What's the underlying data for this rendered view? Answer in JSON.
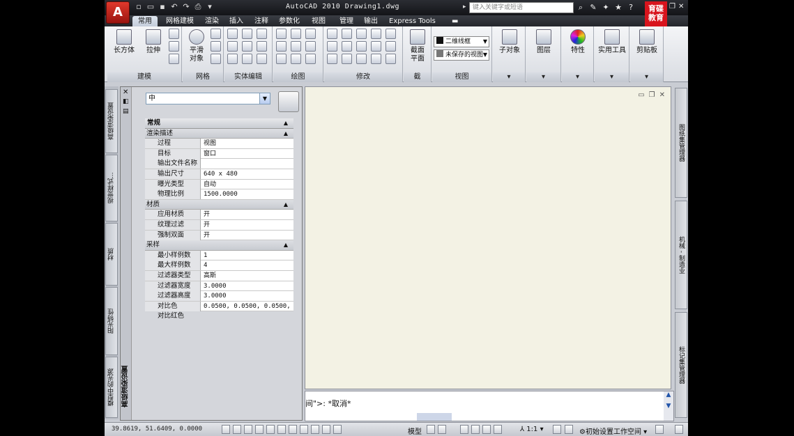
{
  "titlebar": {
    "title": "AutoCAD 2010  Drawing1.dwg",
    "search_placeholder": "键入关键字或短语",
    "logo_line1": "育",
    "logo_line2": "碟",
    "logo_line3": "教育"
  },
  "ribbon_tabs": [
    "常用",
    "网格建模",
    "渲染",
    "插入",
    "注释",
    "参数化",
    "视图",
    "管理",
    "输出",
    "Express Tools"
  ],
  "ribbon": {
    "modeling": {
      "box": "长方体",
      "extrude": "拉伸",
      "label": "建模"
    },
    "mesh": {
      "smooth_line1": "平滑",
      "smooth_line2": "对象",
      "label": "网格"
    },
    "solid_edit": {
      "label": "实体编辑"
    },
    "draw": {
      "label": "绘图"
    },
    "modify": {
      "label": "修改"
    },
    "section": {
      "label": "截",
      "plane_line1": "截面",
      "plane_line2": "平面"
    },
    "view": {
      "visual_style": "二维线框",
      "saved_view": "未保存的视图",
      "label": "视图"
    },
    "subobject": {
      "label": "子对象"
    },
    "layers": {
      "label": "图层"
    },
    "properties": {
      "label": "特性"
    },
    "utilities": {
      "label": "实用工具"
    },
    "clipboard": {
      "label": "剪贴板"
    }
  },
  "left_tabs": [
    "高级渲染设置",
    "视觉样式...",
    "材质",
    "阳光特性",
    "模型中的光源"
  ],
  "palette": {
    "title": "高级渲染设置",
    "preset": "中",
    "section_general": "常规",
    "sub_render": "渲染描述",
    "render_rows": [
      {
        "key": "过程",
        "value": "视图"
      },
      {
        "key": "目标",
        "value": "窗口"
      },
      {
        "key": "输出文件名称",
        "value": ""
      },
      {
        "key": "输出尺寸",
        "value": "640 x 480"
      },
      {
        "key": "曝光类型",
        "value": "自动"
      },
      {
        "key": "物理比例",
        "value": "1500.0000"
      }
    ],
    "sub_material": "材质",
    "material_rows": [
      {
        "key": "应用材质",
        "value": "开"
      },
      {
        "key": "纹理过滤",
        "value": "开"
      },
      {
        "key": "强制双面",
        "value": "开"
      }
    ],
    "sub_sampling": "采样",
    "sampling_rows": [
      {
        "key": "最小样例数",
        "value": "1"
      },
      {
        "key": "最大样例数",
        "value": "4"
      },
      {
        "key": "过滤器类型",
        "value": "高斯"
      },
      {
        "key": "过滤器宽度",
        "value": "3.0000"
      },
      {
        "key": "过滤器高度",
        "value": "3.0000"
      },
      {
        "key": "对比色",
        "value": "0.0500, 0.0500, 0.0500, ..."
      }
    ],
    "last_row": "对比红色"
  },
  "right_tabs": [
    "图纸集管理器",
    "机械 - 制造业",
    "标记集管理器"
  ],
  "command": {
    "text": "间\">: *取消*"
  },
  "status": {
    "coords": "39.8619,  51.6409,  0.0000",
    "model": "模型",
    "scale": "1:1",
    "workspace": "初始设置工作空间"
  }
}
